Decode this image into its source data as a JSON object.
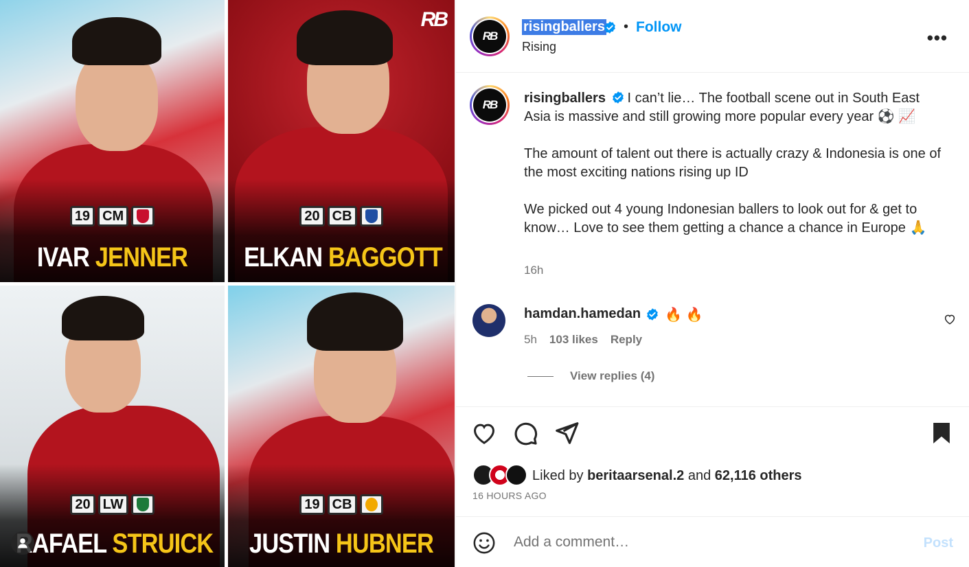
{
  "media": {
    "logo": "RB",
    "tiles": [
      {
        "age": "19",
        "position": "CM",
        "first_name": "IVAR",
        "last_name": "JENNER",
        "club_color": "#c8102e"
      },
      {
        "age": "20",
        "position": "CB",
        "first_name": "ELKAN",
        "last_name": "BAGGOTT",
        "club_color": "#1f4ea3"
      },
      {
        "age": "20",
        "position": "LW",
        "first_name": "RAFAEL",
        "last_name": "STRUICK",
        "club_color": "#1d7a3a"
      },
      {
        "age": "19",
        "position": "CB",
        "first_name": "JUSTIN",
        "last_name": "HUBNER",
        "club_color": "#f2a900"
      }
    ]
  },
  "header": {
    "avatar_text": "RB",
    "username": "risingballers",
    "separator": "•",
    "follow_label": "Follow",
    "subtitle": "Rising",
    "more_label": "•••"
  },
  "caption": {
    "username": "risingballers",
    "paragraph1": "I can’t lie… The football scene out in South East Asia is massive and still growing more popular every year ⚽ 📈",
    "paragraph2": "The amount of talent out there is actually crazy & Indonesia is one of the most exciting nations rising up ID",
    "paragraph3": "We picked out 4 young Indonesian ballers to look out for & get to know… Love to see them getting a chance a chance in Europe 🙏",
    "time": "16h"
  },
  "comment": {
    "username": "hamdan.hamedan",
    "text": "🔥 🔥",
    "time": "5h",
    "likes": "103 likes",
    "reply_label": "Reply",
    "view_replies": "View replies (4)"
  },
  "likes": {
    "liked_by_prefix": "Liked by",
    "liked_by_user": "beritaarsenal.2",
    "and": "and",
    "others": "62,116 others",
    "timestamp": "16 HOURS AGO"
  },
  "comment_box": {
    "placeholder": "Add a comment…",
    "post_label": "Post"
  },
  "colors": {
    "accent": "#0095f6",
    "verified": "#0095f6",
    "name_yellow": "#f5c518"
  }
}
